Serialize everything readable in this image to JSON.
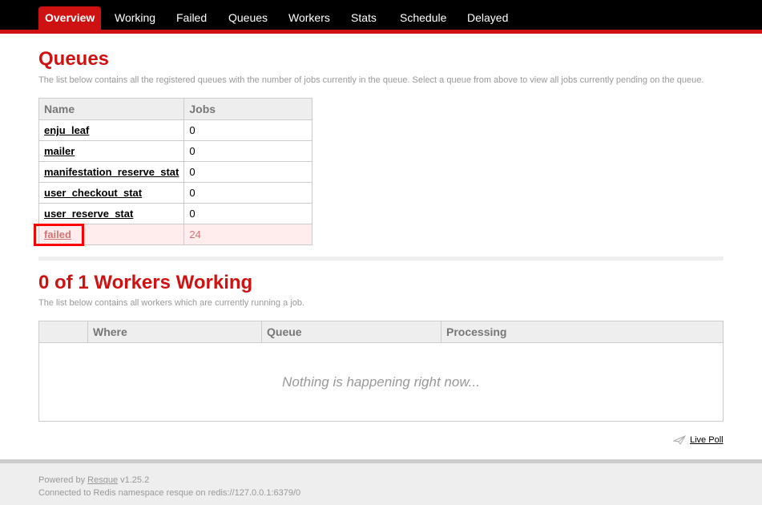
{
  "nav": {
    "tabs": [
      {
        "label": "Overview",
        "active": true
      },
      {
        "label": "Working"
      },
      {
        "label": "Failed"
      },
      {
        "label": "Queues"
      },
      {
        "label": "Workers"
      },
      {
        "label": "Stats"
      },
      {
        "label": "Schedule"
      },
      {
        "label": "Delayed"
      }
    ]
  },
  "queues": {
    "title": "Queues",
    "description": "The list below contains all the registered queues with the number of jobs currently in the queue. Select a queue from above to view all jobs currently pending on the queue.",
    "headers": [
      "Name",
      "Jobs"
    ],
    "rows": [
      {
        "name": "enju_leaf",
        "jobs": "0"
      },
      {
        "name": "mailer",
        "jobs": "0"
      },
      {
        "name": "manifestation_reserve_stat",
        "jobs": "0"
      },
      {
        "name": "user_checkout_stat",
        "jobs": "0"
      },
      {
        "name": "user_reserve_stat",
        "jobs": "0"
      },
      {
        "name": "failed",
        "jobs": "24"
      }
    ]
  },
  "workers": {
    "title": "0 of 1 Workers Working",
    "description": "The list below contains all workers which are currently running a job.",
    "headers": [
      "",
      "Where",
      "Queue",
      "Processing"
    ],
    "empty": "Nothing is happening right now..."
  },
  "live_poll": "Live Poll",
  "footer": {
    "powered_prefix": "Powered by ",
    "resque_link": "Resque",
    "version": " v1.25.2",
    "connection": "Connected to Redis namespace resque on redis://127.0.0.1:6379/0"
  },
  "colors": {
    "accent": "#ce1212",
    "highlight": "#ff0000"
  }
}
